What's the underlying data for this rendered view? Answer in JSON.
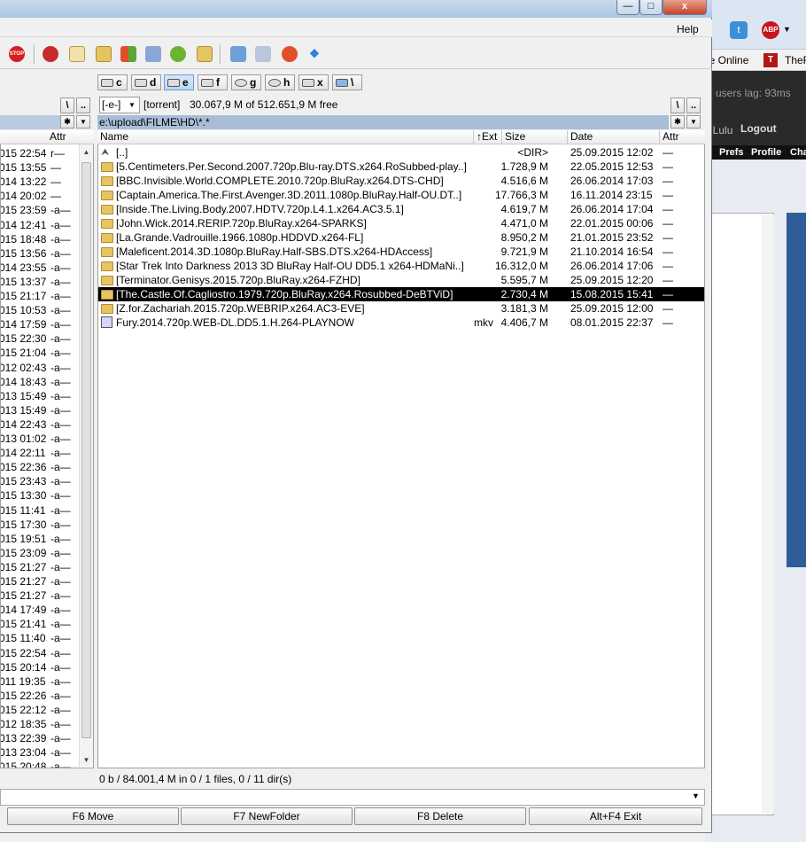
{
  "browser": {
    "online_label": "le Online",
    "tab_partial": "TheF",
    "users_lag": "users lag: 93ms",
    "user_name": "nLulu",
    "logout": "Logout",
    "nav": [
      "Prefs",
      "Profile",
      "Cha"
    ],
    "abp_label": "ABP"
  },
  "window": {
    "minimize": "—",
    "maximize": "□",
    "close": "x"
  },
  "menu": {
    "help": "Help"
  },
  "drives": [
    "c",
    "d",
    "e",
    "f",
    "g",
    "h",
    "x",
    "\\"
  ],
  "left_panel": {
    "attr_header": "Attr",
    "rows": [
      [
        "015 22:54",
        "r—"
      ],
      [
        "015 13:55",
        "—"
      ],
      [
        "014 13:22",
        "—"
      ],
      [
        "014 20:02",
        "—"
      ],
      [
        "015 23:59",
        "-a—"
      ],
      [
        "014 12:41",
        "-a—"
      ],
      [
        "015 18:48",
        "-a—"
      ],
      [
        "015 13:56",
        "-a—"
      ],
      [
        "014 23:55",
        "-a—"
      ],
      [
        "015 13:37",
        "-a—"
      ],
      [
        "015 21:17",
        "-a—"
      ],
      [
        "015 10:53",
        "-a—"
      ],
      [
        "014 17:59",
        "-a—"
      ],
      [
        "015 22:30",
        "-a—"
      ],
      [
        "015 21:04",
        "-a—"
      ],
      [
        "012 02:43",
        "-a—"
      ],
      [
        "014 18:43",
        "-a—"
      ],
      [
        "013 15:49",
        "-a—"
      ],
      [
        "013 15:49",
        "-a—"
      ],
      [
        "014 22:43",
        "-a—"
      ],
      [
        "013 01:02",
        "-a—"
      ],
      [
        "014 22:11",
        "-a—"
      ],
      [
        "015 22:36",
        "-a—"
      ],
      [
        "015 23:43",
        "-a—"
      ],
      [
        "015 13:30",
        "-a—"
      ],
      [
        "015 11:41",
        "-a—"
      ],
      [
        "015 17:30",
        "-a—"
      ],
      [
        "015 19:51",
        "-a—"
      ],
      [
        "015 23:09",
        "-a—"
      ],
      [
        "015 21:27",
        "-a—"
      ],
      [
        "015 21:27",
        "-a—"
      ],
      [
        "015 21:27",
        "-a—"
      ],
      [
        "014 17:49",
        "-a—"
      ],
      [
        "015 21:41",
        "-a—"
      ],
      [
        "015 11:40",
        "-a—"
      ],
      [
        "015 22:54",
        "-a—"
      ],
      [
        "015 20:14",
        "-a—"
      ],
      [
        "011 19:35",
        "-a—"
      ],
      [
        "015 22:26",
        "-a—"
      ],
      [
        "015 22:12",
        "-a—"
      ],
      [
        "012 18:35",
        "-a—"
      ],
      [
        "013 22:39",
        "-a—"
      ],
      [
        "013 23:04",
        "-a—"
      ],
      [
        "015 20:48",
        "-a—"
      ]
    ]
  },
  "right_panel": {
    "drive_select": "[-e-]",
    "volume_label": "[torrent]",
    "free_space": "30.067,9 M of 512.651,9 M free",
    "path": "e:\\upload\\FILME\\HD\\*.*",
    "headers": {
      "name": "Name",
      "ext": "↑Ext",
      "size": "Size",
      "date": "Date",
      "attr": "Attr"
    },
    "rows": [
      {
        "icon": "updir",
        "name": "[..]",
        "ext": "",
        "size": "<DIR>",
        "date": "25.09.2015 12:02",
        "attr": "—"
      },
      {
        "icon": "folder",
        "name": "[5.Centimeters.Per.Second.2007.720p.Blu-ray.DTS.x264.RoSubbed-play..]",
        "ext": "",
        "size": "1.728,9 M",
        "date": "22.05.2015 12:53",
        "attr": "—"
      },
      {
        "icon": "folder",
        "name": "[BBC.Invisible.World.COMPLETE.2010.720p.BluRay.x264.DTS-CHD]",
        "ext": "",
        "size": "4.516,6 M",
        "date": "26.06.2014 17:03",
        "attr": "—"
      },
      {
        "icon": "folder",
        "name": "[Captain.America.The.First.Avenger.3D.2011.1080p.BluRay.Half-OU.DT..]",
        "ext": "",
        "size": "17.766,3 M",
        "date": "16.11.2014 23:15",
        "attr": "—"
      },
      {
        "icon": "folder",
        "name": "[Inside.The.Living.Body.2007.HDTV.720p.L4.1.x264.AC3.5.1]",
        "ext": "",
        "size": "4.619,7 M",
        "date": "26.06.2014 17:04",
        "attr": "—"
      },
      {
        "icon": "folder",
        "name": "[John.Wick.2014.RERIP.720p.BluRay.x264-SPARKS]",
        "ext": "",
        "size": "4.471,0 M",
        "date": "22.01.2015 00:06",
        "attr": "—"
      },
      {
        "icon": "folder",
        "name": "[La.Grande.Vadrouille.1966.1080p.HDDVD.x264-FL]",
        "ext": "",
        "size": "8.950,2 M",
        "date": "21.01.2015 23:52",
        "attr": "—"
      },
      {
        "icon": "folder",
        "name": "[Maleficent.2014.3D.1080p.BluRay.Half-SBS.DTS.x264-HDAccess]",
        "ext": "",
        "size": "9.721,9 M",
        "date": "21.10.2014 16:54",
        "attr": "—"
      },
      {
        "icon": "folder",
        "name": "[Star Trek Into Darkness 2013 3D BluRay Half-OU DD5.1 x264-HDMaNi..]",
        "ext": "",
        "size": "16.312,0 M",
        "date": "26.06.2014 17:06",
        "attr": "—"
      },
      {
        "icon": "folder",
        "name": "[Terminator.Genisys.2015.720p.BluRay.x264-FZHD]",
        "ext": "",
        "size": "5.595,7 M",
        "date": "25.09.2015 12:20",
        "attr": "—"
      },
      {
        "icon": "folder",
        "name": "[The.Castle.Of.Cagliostro.1979.720p.BluRay.x264.Rosubbed-DeBTViD]",
        "ext": "",
        "size": "2.730,4 M",
        "date": "15.08.2015 15:41",
        "attr": "—",
        "selected": true
      },
      {
        "icon": "folder",
        "name": "[Z.for.Zachariah.2015.720p.WEBRIP.x264.AC3-EVE]",
        "ext": "",
        "size": "3.181,3 M",
        "date": "25.09.2015 12:00",
        "attr": "—"
      },
      {
        "icon": "mkv",
        "name": "Fury.2014.720p.WEB-DL.DD5.1.H.264-PLAYNOW",
        "ext": "mkv",
        "size": "4.406,7 M",
        "date": "08.01.2015 22:37",
        "attr": "—"
      }
    ]
  },
  "status": "0 b / 84.001,4 M in 0 / 1 files, 0 / 11 dir(s)",
  "fkeys": [
    "F6 Move",
    "F7 NewFolder",
    "F8 Delete",
    "Alt+F4 Exit"
  ]
}
